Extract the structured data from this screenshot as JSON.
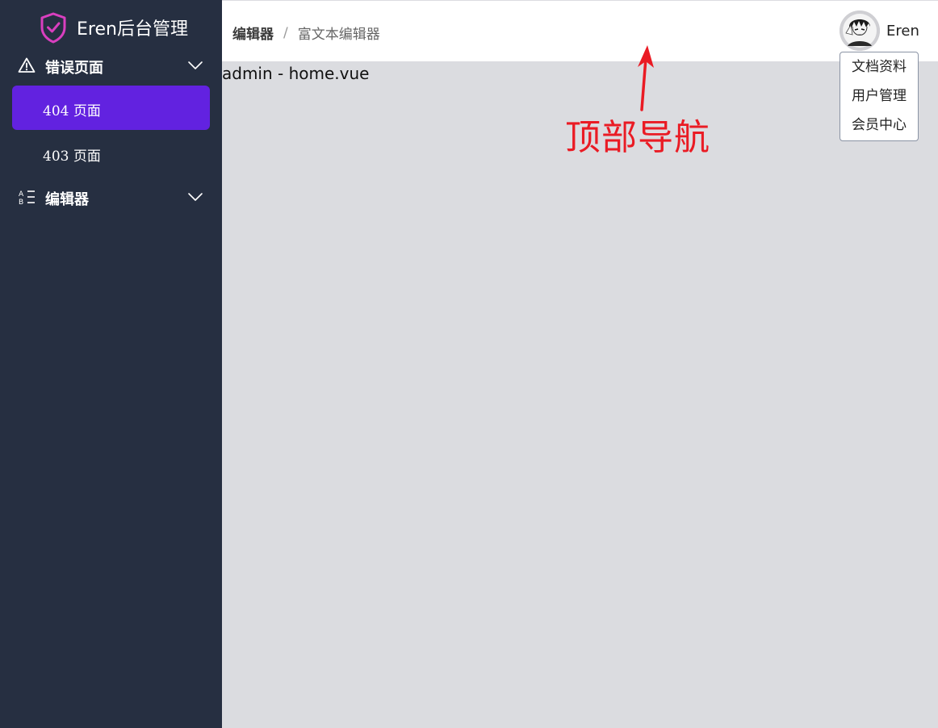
{
  "app": {
    "title": "Eren后台管理"
  },
  "sidebar": {
    "groups": [
      {
        "label": "错误页面",
        "icon": "warning-triangle-icon",
        "items": [
          {
            "label": "404 页面",
            "active": true
          },
          {
            "label": "403 页面",
            "active": false
          }
        ]
      },
      {
        "label": "编辑器",
        "icon": "text-abc-list-icon",
        "items": []
      }
    ]
  },
  "header": {
    "breadcrumb": [
      "编辑器",
      "富文本编辑器"
    ],
    "breadcrumb_separator": "/",
    "user": {
      "name": "Eren"
    }
  },
  "dropdown": {
    "items": [
      "文档资料",
      "用户管理",
      "会员中心"
    ]
  },
  "content": {
    "text": "admin - home.vue"
  },
  "annotation": {
    "label": "顶部导航"
  },
  "colors": {
    "sidebar_bg": "#262f41",
    "active_item_bg": "#6222e0",
    "logo_accent": "#d93fbf",
    "content_bg": "#dbdce0",
    "annotation_red": "#ea1b24"
  }
}
